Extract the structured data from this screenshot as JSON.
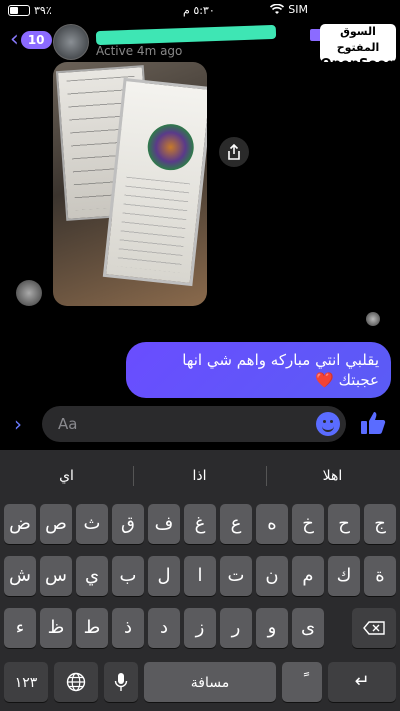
{
  "status_bar": {
    "battery": "٣٩٪",
    "battery_level": 0.39,
    "time": "٥:٣٠ م",
    "carrier": "SIM"
  },
  "header": {
    "back_count": "10",
    "active_status": "Active 4m ago"
  },
  "watermark": {
    "arabic": "السوق المفتوح",
    "english": "OpenSooq"
  },
  "chat": {
    "message": "يقلبي انتي مباركه واهم شي انها عجبتك ❤️"
  },
  "composer": {
    "placeholder": "Aa"
  },
  "keyboard": {
    "suggestions": [
      "اي",
      "اذا",
      "اهلا"
    ],
    "row1": [
      "ض",
      "ص",
      "ث",
      "ق",
      "ف",
      "غ",
      "ع",
      "ه",
      "خ",
      "ح",
      "ج"
    ],
    "row2": [
      "ش",
      "س",
      "ي",
      "ب",
      "ل",
      "ا",
      "ت",
      "ن",
      "م",
      "ك",
      "ة"
    ],
    "row3": [
      "ء",
      "ظ",
      "ط",
      "ذ",
      "د",
      "ز",
      "ر",
      "و",
      "ى"
    ],
    "numbers_key": "١٢٣",
    "space_key": "مسافة",
    "diacritic_key": "ً",
    "return_key": "↵"
  },
  "icons": {
    "back": "chevron-left-icon",
    "video": "video-call-icon",
    "share": "share-icon",
    "emoji": "emoji-icon",
    "like": "thumbs-up-icon",
    "globe": "globe-icon",
    "mic": "microphone-icon",
    "backspace": "backspace-icon"
  },
  "colors": {
    "accent": "#6a4dff",
    "bubble": "#5a5cf5",
    "keyboard_bg": "#2b2b2d"
  }
}
